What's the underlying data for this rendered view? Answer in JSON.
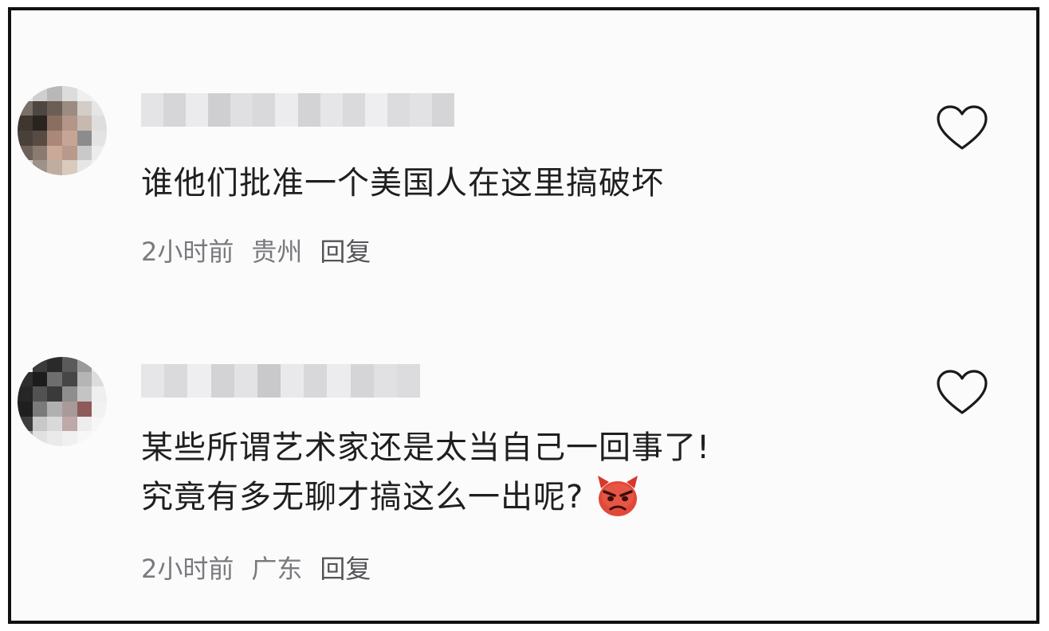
{
  "comments": [
    {
      "text_lines": [
        "谁他们批准一个美国人在这里搞破坏"
      ],
      "time": "2小时前",
      "location": "贵州",
      "reply_label": "回复",
      "like_icon": "heart-outline-icon"
    },
    {
      "text_lines": [
        "某些所谓艺术家还是太当自己一回事了!",
        "究竟有多无聊才搞这么一出呢?"
      ],
      "emoji_icon": "angry-devil-emoji-icon",
      "time": "2小时前",
      "location": "广东",
      "reply_label": "回复",
      "like_icon": "heart-outline-icon"
    }
  ],
  "colors": {
    "text": "#1f1f1f",
    "meta": "#7a7a7e",
    "border": "#111111",
    "background": "#fbfbfc",
    "emoji": "#e0493a"
  }
}
